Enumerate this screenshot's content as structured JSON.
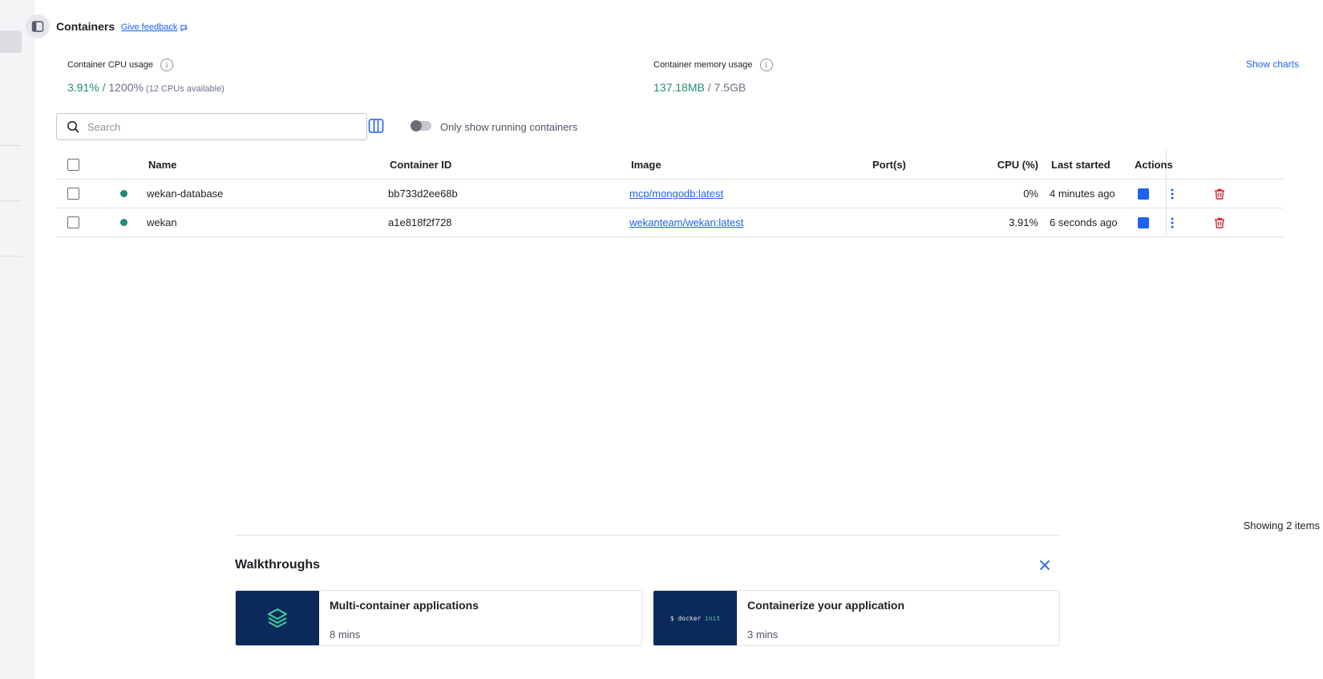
{
  "header": {
    "title": "Containers",
    "feedback_label": "Give feedback"
  },
  "stats": {
    "cpu": {
      "label": "Container CPU usage",
      "value": "3.91%",
      "total": " / 1200%",
      "note": " (12 CPUs available)"
    },
    "memory": {
      "label": "Container memory usage",
      "value": "137.18MB",
      "total": " / 7.5GB"
    },
    "show_charts_label": "Show charts"
  },
  "toolbar": {
    "search_placeholder": "Search",
    "running_toggle_label": "Only show running containers",
    "running_toggle_on": false
  },
  "table": {
    "columns": {
      "name": "Name",
      "container_id": "Container ID",
      "image": "Image",
      "ports": "Port(s)",
      "cpu": "CPU (%)",
      "last_started": "Last started",
      "actions": "Actions"
    },
    "rows": [
      {
        "name": "wekan-database",
        "container_id": "bb733d2ee68b",
        "image": "mcp/mongodb:latest",
        "ports": "",
        "cpu": "0%",
        "last_started": "4 minutes ago",
        "status_color": "#218a76"
      },
      {
        "name": "wekan",
        "container_id": "a1e818f2f728",
        "image": "wekanteam/wekan:latest",
        "ports": "",
        "cpu": "3.91%",
        "last_started": "6 seconds ago",
        "status_color": "#218a76"
      }
    ],
    "footer": "Showing 2 items"
  },
  "walkthroughs": {
    "title": "Walkthroughs",
    "cards": [
      {
        "title": "Multi-container applications",
        "duration": "8 mins",
        "icon": "layers-icon"
      },
      {
        "title": "Containerize your application",
        "duration": "3 mins",
        "terminal_prompt": "$ docker",
        "terminal_cmd": "init"
      }
    ]
  },
  "colors": {
    "accent": "#1d63ed",
    "running": "#218a76",
    "danger": "#d52536",
    "walkthrough_bg": "#0b2a5b"
  }
}
